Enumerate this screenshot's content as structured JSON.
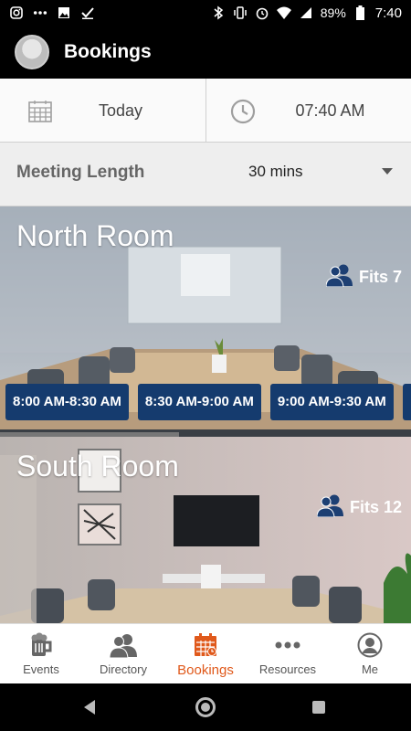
{
  "status_bar": {
    "battery": "89%",
    "time": "7:40",
    "left_icons": [
      "instagram-icon",
      "dots-icon",
      "image-icon",
      "check-icon"
    ],
    "right_icons": [
      "bluetooth-icon",
      "vibrate-icon",
      "alarm-icon",
      "wifi-icon",
      "signal-icon",
      "battery-icon"
    ]
  },
  "app_bar": {
    "title": "Bookings"
  },
  "date_time": {
    "date": "Today",
    "time": "07:40 AM"
  },
  "meeting_length": {
    "label": "Meeting Length",
    "value": "30 mins"
  },
  "rooms": [
    {
      "name": "North Room",
      "fits": "Fits 7",
      "slots": [
        "8:00 AM-8:30 AM",
        "8:30 AM-9:00 AM",
        "9:00 AM-9:30 AM"
      ]
    },
    {
      "name": "South Room",
      "fits": "Fits 12"
    }
  ],
  "tabs": [
    {
      "label": "Events",
      "icon": "beer-mug-icon"
    },
    {
      "label": "Directory",
      "icon": "people-icon"
    },
    {
      "label": "Bookings",
      "icon": "calendar-icon"
    },
    {
      "label": "Resources",
      "icon": "more-dots-icon"
    },
    {
      "label": "Me",
      "icon": "person-icon"
    }
  ],
  "colors": {
    "accent": "#e0591b",
    "slot_bg": "#153b6e",
    "fits_icon": "#1d3f73"
  }
}
